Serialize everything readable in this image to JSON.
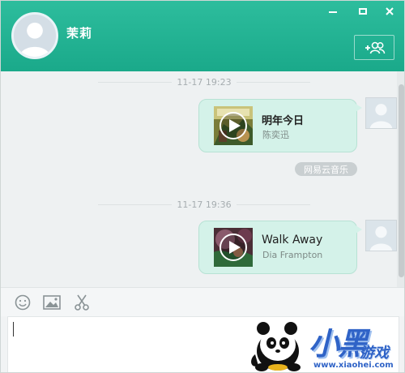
{
  "header": {
    "contact_name": "茉莉",
    "add_friend_label": "+"
  },
  "messages": [
    {
      "time": "11-17 19:23",
      "song_title": "明年今日",
      "artist": "陈奕迅",
      "source": "网易云音乐"
    },
    {
      "time": "11-17 19:36",
      "song_title": "Walk Away",
      "artist": "Dia Frampton"
    }
  ],
  "input": {
    "value": ""
  },
  "watermark": {
    "brand": "小黑",
    "suffix": "游戏",
    "url": "www.xiaohei.com"
  },
  "colors": {
    "header": "#1fb292",
    "bubble": "#d4f2e9",
    "source_tag": "#c9cfd1"
  },
  "icons": {
    "toolbar": [
      "emoji-icon",
      "image-icon",
      "scissors-icon"
    ],
    "window": [
      "minimize-icon",
      "maximize-icon",
      "close-icon"
    ]
  }
}
